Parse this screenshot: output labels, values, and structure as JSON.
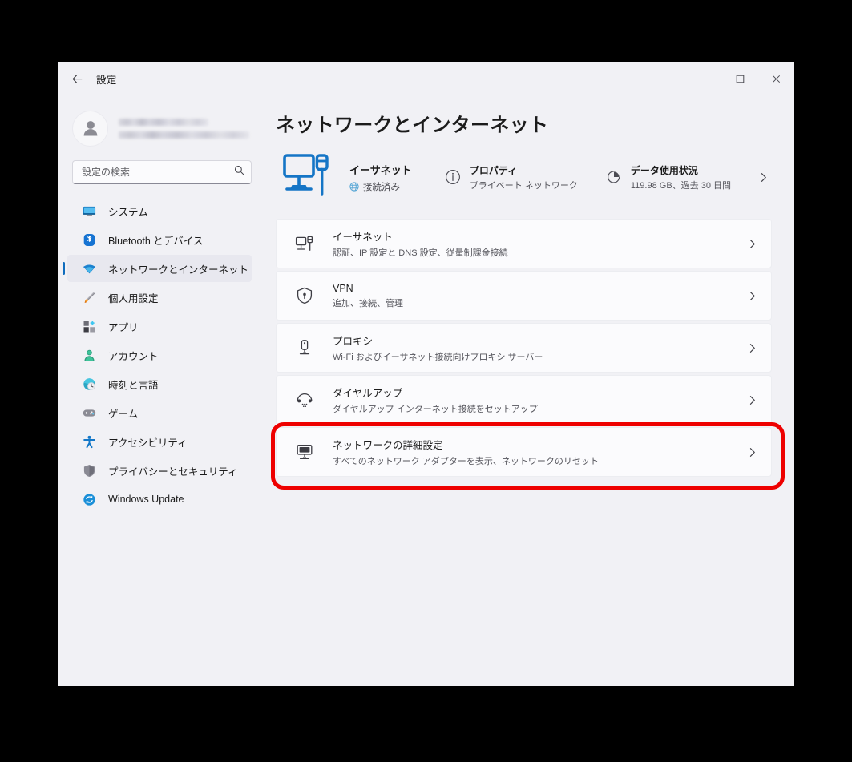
{
  "window": {
    "app_title": "設定",
    "back_label": "back-arrow",
    "controls": {
      "minimize": "—",
      "maximize": "□",
      "close": "✕"
    }
  },
  "sidebar": {
    "profile": {
      "name_redacted": "",
      "email_redacted": ""
    },
    "search": {
      "placeholder": "設定の検索",
      "value": ""
    },
    "items": [
      {
        "label": "システム",
        "icon": "system-monitor-icon",
        "selected": false
      },
      {
        "label": "Bluetooth とデバイス",
        "icon": "bluetooth-icon",
        "selected": false
      },
      {
        "label": "ネットワークとインターネット",
        "icon": "wifi-icon",
        "selected": true
      },
      {
        "label": "個人用設定",
        "icon": "paintbrush-icon",
        "selected": false
      },
      {
        "label": "アプリ",
        "icon": "apps-icon",
        "selected": false
      },
      {
        "label": "アカウント",
        "icon": "account-person-icon",
        "selected": false
      },
      {
        "label": "時刻と言語",
        "icon": "clock-globe-icon",
        "selected": false
      },
      {
        "label": "ゲーム",
        "icon": "gamepad-icon",
        "selected": false
      },
      {
        "label": "アクセシビリティ",
        "icon": "accessibility-icon",
        "selected": false
      },
      {
        "label": "プライバシーとセキュリティ",
        "icon": "shield-icon",
        "selected": false
      },
      {
        "label": "Windows Update",
        "icon": "update-refresh-icon",
        "selected": false
      }
    ]
  },
  "main": {
    "page_title": "ネットワークとインターネット",
    "hero": {
      "icon": "ethernet-desktop-icon",
      "name": "イーサネット",
      "status": "接続済み",
      "status_icon": "globe-icon",
      "kpis": [
        {
          "icon": "info-circle-icon",
          "title": "プロパティ",
          "sub": "プライベート ネットワーク"
        },
        {
          "icon": "pie-chart-icon",
          "title": "データ使用状況",
          "sub": "119.98 GB、過去 30 日間"
        }
      ],
      "chevron": "chevron-right-icon"
    },
    "cards": [
      {
        "icon": "ethernet-port-icon",
        "title": "イーサネット",
        "sub": "認証、IP 設定と DNS 設定、従量制課金接続",
        "highlighted": false
      },
      {
        "icon": "vpn-shield-icon",
        "title": "VPN",
        "sub": "追加、接続、管理",
        "highlighted": false
      },
      {
        "icon": "proxy-server-icon",
        "title": "プロキシ",
        "sub": "Wi-Fi およびイーサネット接続向けプロキシ サーバー",
        "highlighted": false
      },
      {
        "icon": "dialup-modem-icon",
        "title": "ダイヤルアップ",
        "sub": "ダイヤルアップ インターネット接続をセットアップ",
        "highlighted": false
      },
      {
        "icon": "network-advanced-icon",
        "title": "ネットワークの詳細設定",
        "sub": "すべてのネットワーク アダプターを表示、ネットワークのリセット",
        "highlighted": true
      }
    ]
  },
  "colors": {
    "page_background": "#f1f1f5",
    "card_background": "#fbfbfd",
    "accent": "#0f6cbd",
    "highlight_ring": "#ee0000",
    "selected_nav": "#e8e8ef",
    "text_primary": "#1b1b1b",
    "text_secondary": "#55555c"
  }
}
